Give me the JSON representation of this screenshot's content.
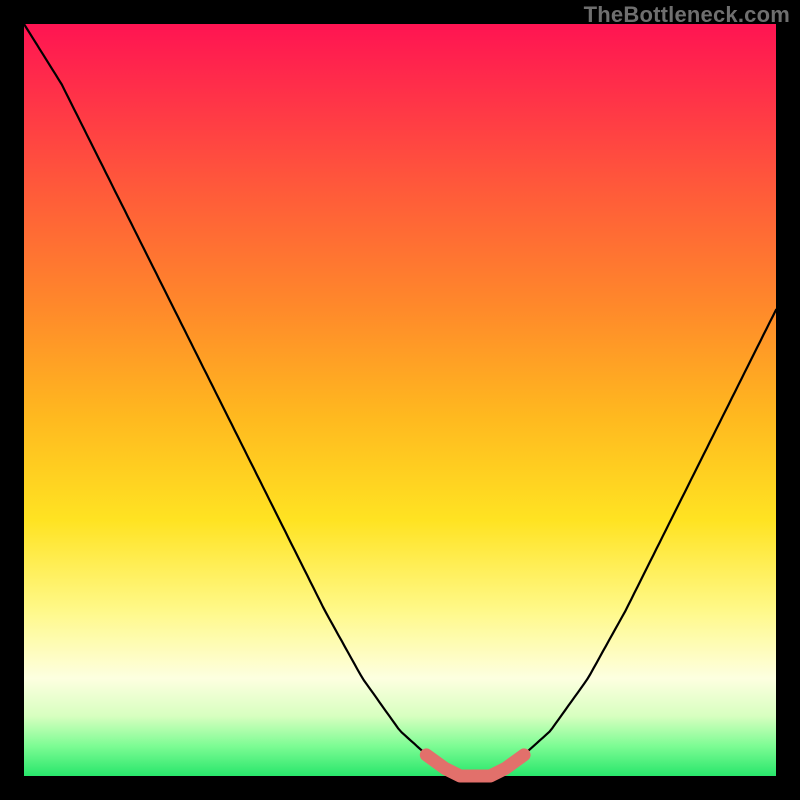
{
  "watermark": "TheBottleneck.com",
  "chart_data": {
    "type": "line",
    "title": "",
    "xlabel": "",
    "ylabel": "",
    "xlim": [
      0,
      1
    ],
    "ylim": [
      0,
      1
    ],
    "grid": false,
    "x": [
      0.0,
      0.05,
      0.1,
      0.15,
      0.2,
      0.25,
      0.3,
      0.35,
      0.4,
      0.45,
      0.5,
      0.55,
      0.58,
      0.62,
      0.65,
      0.7,
      0.75,
      0.8,
      0.85,
      0.9,
      0.95,
      1.0
    ],
    "series": [
      {
        "name": "bottleneck-curve",
        "color": "#000000",
        "values": [
          1.0,
          0.92,
          0.82,
          0.72,
          0.62,
          0.52,
          0.42,
          0.32,
          0.22,
          0.13,
          0.06,
          0.015,
          0.0,
          0.0,
          0.015,
          0.06,
          0.13,
          0.22,
          0.32,
          0.42,
          0.52,
          0.62
        ]
      }
    ],
    "annotations": [
      {
        "name": "valley-highlight",
        "color": "#e2706b",
        "x": [
          0.535,
          0.56,
          0.58,
          0.62,
          0.64,
          0.665
        ],
        "values": [
          0.028,
          0.01,
          0.0,
          0.0,
          0.01,
          0.028
        ]
      }
    ]
  }
}
